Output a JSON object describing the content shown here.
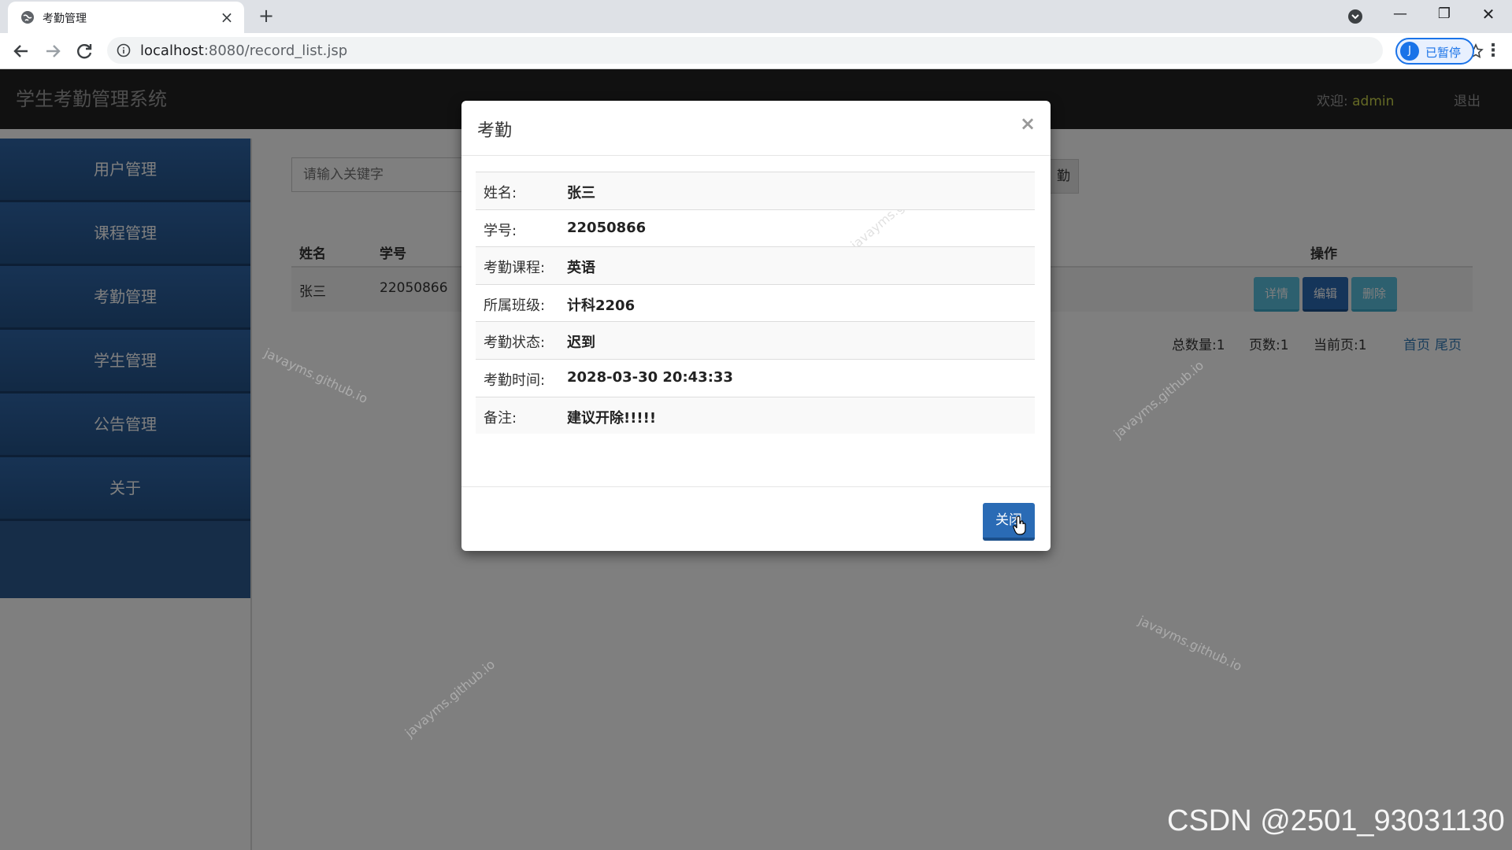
{
  "browser": {
    "tab_title": "考勤管理",
    "tab_close": "×",
    "new_tab": "+",
    "url_host": "localhost",
    "url_rest": ":8080/record_list.jsp",
    "profile_initial": "J",
    "profile_label": "已暂停",
    "menu": "⋮",
    "window": {
      "minimize": "—",
      "maximize": "❐",
      "close": "✕"
    }
  },
  "app": {
    "title": "学生考勤管理系统",
    "welcome_label": "欢迎:",
    "welcome_user": "admin",
    "logout": "退出"
  },
  "sidebar": {
    "items": [
      {
        "label": "用户管理"
      },
      {
        "label": "课程管理"
      },
      {
        "label": "考勤管理"
      },
      {
        "label": "学生管理"
      },
      {
        "label": "公告管理"
      },
      {
        "label": "关于"
      }
    ]
  },
  "search": {
    "placeholder": "请输入关键字"
  },
  "add_button": {
    "partial_label": "勤"
  },
  "table": {
    "headers": {
      "name": "姓名",
      "id": "学号",
      "actions": "操作"
    },
    "rows": [
      {
        "name": "张三",
        "id": "22050866"
      }
    ],
    "actions": {
      "detail": "详情",
      "edit": "编辑",
      "delete": "删除"
    }
  },
  "pager": {
    "total": "总数量:1",
    "pages": "页数:1",
    "current": "当前页:1",
    "first": "首页",
    "last": "尾页"
  },
  "modal": {
    "title": "考勤",
    "close_x": "×",
    "fields": [
      {
        "label": "姓名:",
        "value": "张三"
      },
      {
        "label": "学号:",
        "value": "22050866"
      },
      {
        "label": "考勤课程:",
        "value": "英语"
      },
      {
        "label": "所属班级:",
        "value": "计科2206"
      },
      {
        "label": "考勤状态:",
        "value": "迟到"
      },
      {
        "label": "考勤时间:",
        "value": "2028-03-30 20:43:33"
      },
      {
        "label": "备注:",
        "value": "建议开除!!!!!"
      }
    ],
    "close_button": "关闭"
  },
  "watermarks": {
    "text": "javayms.github.io",
    "csdn": "CSDN @2501_93031130"
  },
  "colors": {
    "topnav": "#222222",
    "sidebar": "#2f66a8",
    "primary": "#2a6bb5",
    "info": "#5bc0de",
    "welcome_user": "#c9d34a"
  }
}
